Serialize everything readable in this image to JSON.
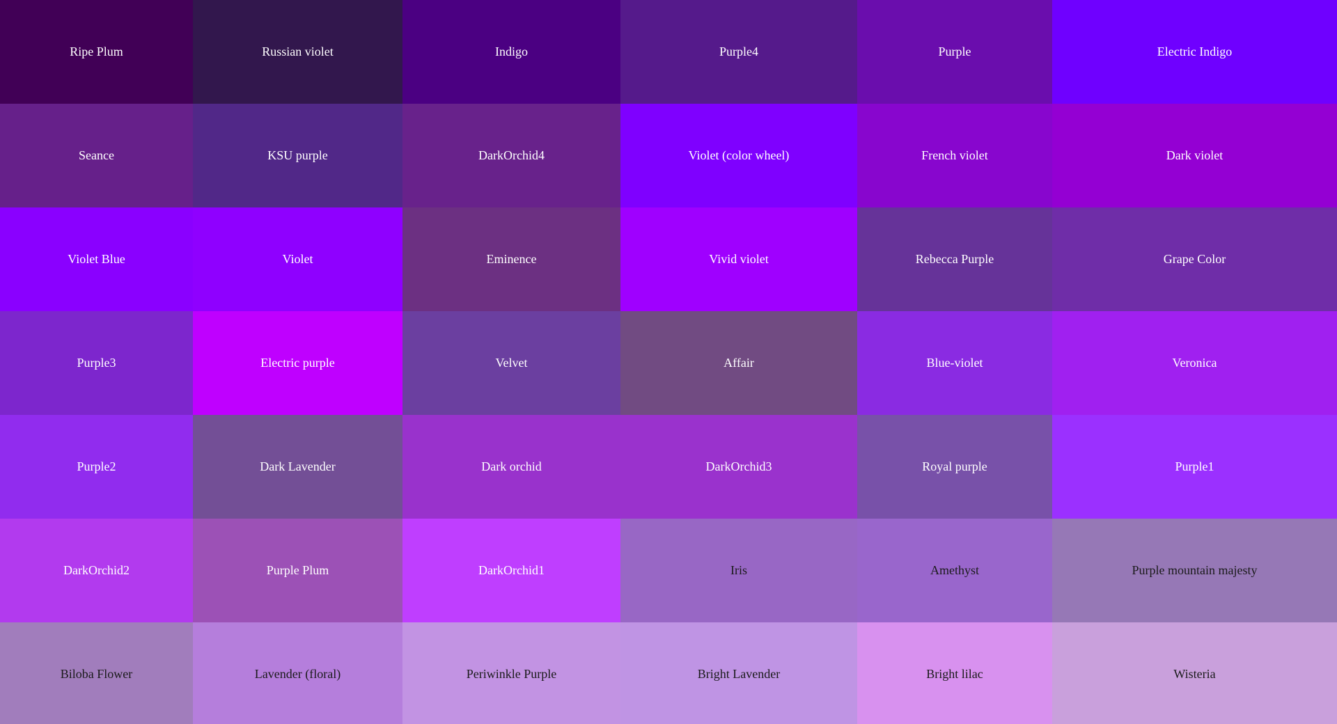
{
  "swatches": [
    {
      "name": "Ripe Plum",
      "color": "#410056",
      "text_color": "#ffffff"
    },
    {
      "name": "Russian violet",
      "color": "#32174d",
      "text_color": "#ffffff"
    },
    {
      "name": "Indigo",
      "color": "#4b0082",
      "text_color": "#ffffff"
    },
    {
      "name": "Purple4",
      "color": "#551a8b",
      "text_color": "#ffffff"
    },
    {
      "name": "Purple",
      "color": "#6a0dad",
      "text_color": "#ffffff"
    },
    {
      "name": "Electric Indigo",
      "color": "#6f00ff",
      "text_color": "#ffffff"
    },
    {
      "name": "Seance",
      "color": "#66208a",
      "text_color": "#ffffff"
    },
    {
      "name": "KSU purple",
      "color": "#512888",
      "text_color": "#ffffff"
    },
    {
      "name": "DarkOrchid4",
      "color": "#68228b",
      "text_color": "#ffffff"
    },
    {
      "name": "Violet (color wheel)",
      "color": "#7f00ff",
      "text_color": "#ffffff"
    },
    {
      "name": "French violet",
      "color": "#8806ce",
      "text_color": "#ffffff"
    },
    {
      "name": "Dark violet",
      "color": "#9400d3",
      "text_color": "#ffffff"
    },
    {
      "name": "Violet Blue",
      "color": "#8a00ff",
      "text_color": "#ffffff"
    },
    {
      "name": "Violet",
      "color": "#8f00ff",
      "text_color": "#ffffff"
    },
    {
      "name": "Eminence",
      "color": "#6c3082",
      "text_color": "#ffffff"
    },
    {
      "name": "Vivid violet",
      "color": "#9f00ff",
      "text_color": "#ffffff"
    },
    {
      "name": "Rebecca Purple",
      "color": "#663399",
      "text_color": "#ffffff"
    },
    {
      "name": "Grape Color",
      "color": "#6f2da8",
      "text_color": "#ffffff"
    },
    {
      "name": "Purple3",
      "color": "#7d26cd",
      "text_color": "#ffffff"
    },
    {
      "name": "Electric purple",
      "color": "#bf00ff",
      "text_color": "#ffffff"
    },
    {
      "name": "Velvet",
      "color": "#6b3fa0",
      "text_color": "#ffffff"
    },
    {
      "name": "Affair",
      "color": "#714b82",
      "text_color": "#ffffff"
    },
    {
      "name": "Blue-violet",
      "color": "#8a2be2",
      "text_color": "#ffffff"
    },
    {
      "name": "Veronica",
      "color": "#a020f0",
      "text_color": "#ffffff"
    },
    {
      "name": "Purple2",
      "color": "#912cee",
      "text_color": "#ffffff"
    },
    {
      "name": "Dark Lavender",
      "color": "#734f96",
      "text_color": "#ffffff"
    },
    {
      "name": "Dark orchid",
      "color": "#9932cc",
      "text_color": "#ffffff"
    },
    {
      "name": "DarkOrchid3",
      "color": "#9a32cd",
      "text_color": "#ffffff"
    },
    {
      "name": "Royal purple",
      "color": "#7851a9",
      "text_color": "#ffffff"
    },
    {
      "name": "Purple1",
      "color": "#9b30ff",
      "text_color": "#ffffff"
    },
    {
      "name": "DarkOrchid2",
      "color": "#b23aee",
      "text_color": "#ffffff"
    },
    {
      "name": "Purple Plum",
      "color": "#9c51b6",
      "text_color": "#ffffff"
    },
    {
      "name": "DarkOrchid1",
      "color": "#bf3eff",
      "text_color": "#ffffff"
    },
    {
      "name": "Iris",
      "color": "#9867c5",
      "text_color": "#1a1a1a"
    },
    {
      "name": "Amethyst",
      "color": "#9966cc",
      "text_color": "#1a1a1a"
    },
    {
      "name": "Purple mountain majesty",
      "color": "#9678b6",
      "text_color": "#1a1a1a"
    },
    {
      "name": "Biloba Flower",
      "color": "#a17dbc",
      "text_color": "#1a1a1a"
    },
    {
      "name": "Lavender (floral)",
      "color": "#b57edc",
      "text_color": "#1a1a1a"
    },
    {
      "name": "Periwinkle Purple",
      "color": "#c293e3",
      "text_color": "#1a1a1a"
    },
    {
      "name": "Bright Lavender",
      "color": "#bf94e4",
      "text_color": "#1a1a1a"
    },
    {
      "name": "Bright lilac",
      "color": "#d891ef",
      "text_color": "#1a1a1a"
    },
    {
      "name": "Wisteria",
      "color": "#c9a0dc",
      "text_color": "#1a1a1a"
    }
  ]
}
